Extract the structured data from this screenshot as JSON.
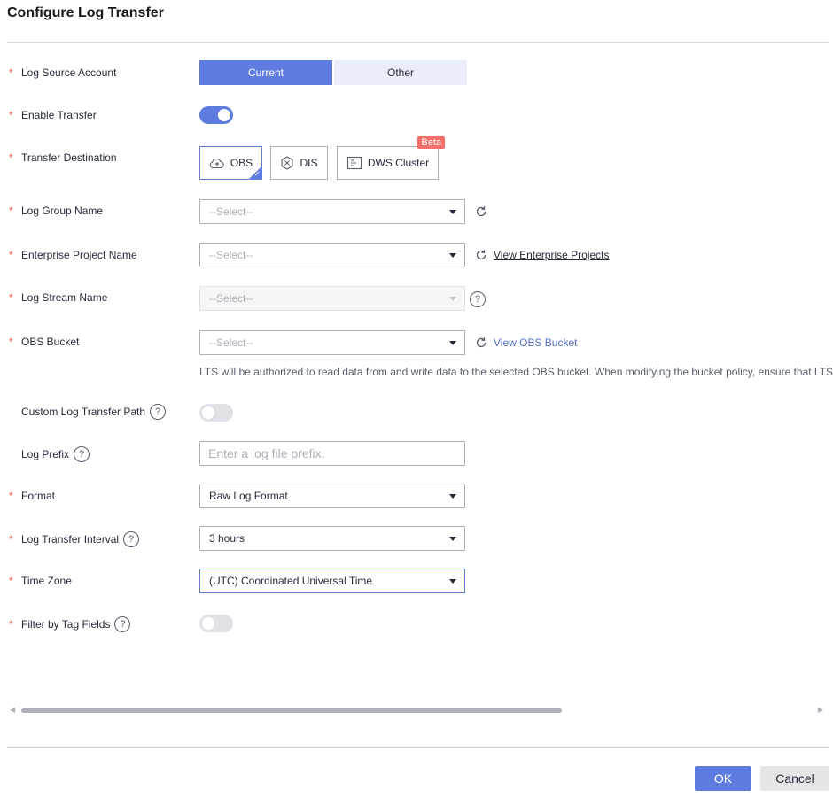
{
  "dialog": {
    "title": "Configure Log Transfer"
  },
  "form": {
    "log_source_account": {
      "label": "Log Source Account",
      "options": [
        "Current",
        "Other"
      ],
      "selected": "Current"
    },
    "enable_transfer": {
      "label": "Enable Transfer",
      "enabled": true
    },
    "transfer_destination": {
      "label": "Transfer Destination",
      "options": [
        {
          "label": "OBS",
          "icon": "cloud-upload-icon",
          "selected": true
        },
        {
          "label": "DIS",
          "icon": "hexagon-icon",
          "selected": false
        },
        {
          "label": "DWS Cluster",
          "icon": "database-icon",
          "selected": false,
          "badge": "Beta"
        }
      ]
    },
    "log_group_name": {
      "label": "Log Group Name",
      "placeholder": "--Select--"
    },
    "enterprise_project_name": {
      "label": "Enterprise Project Name",
      "placeholder": "--Select--",
      "link": "View Enterprise Projects"
    },
    "log_stream_name": {
      "label": "Log Stream Name",
      "placeholder": "--Select--",
      "disabled": true
    },
    "obs_bucket": {
      "label": "OBS Bucket",
      "placeholder": "--Select--",
      "link": "View OBS Bucket",
      "note": "LTS will be authorized to read data from and write data to the selected OBS bucket. When modifying the bucket policy, ensure that LTS"
    },
    "custom_log_transfer_path": {
      "label": "Custom Log Transfer Path",
      "enabled": false
    },
    "log_prefix": {
      "label": "Log Prefix",
      "placeholder": "Enter a log file prefix."
    },
    "format": {
      "label": "Format",
      "value": "Raw Log Format"
    },
    "log_transfer_interval": {
      "label": "Log Transfer Interval",
      "value": "3 hours"
    },
    "time_zone": {
      "label": "Time Zone",
      "value": "(UTC) Coordinated Universal Time"
    },
    "filter_by_tag_fields": {
      "label": "Filter by Tag Fields",
      "enabled": false
    }
  },
  "footer": {
    "ok_label": "OK",
    "cancel_label": "Cancel"
  },
  "colors": {
    "accent": "#5e7ce0",
    "required": "#f15a4a",
    "beta": "#f66f6a"
  }
}
